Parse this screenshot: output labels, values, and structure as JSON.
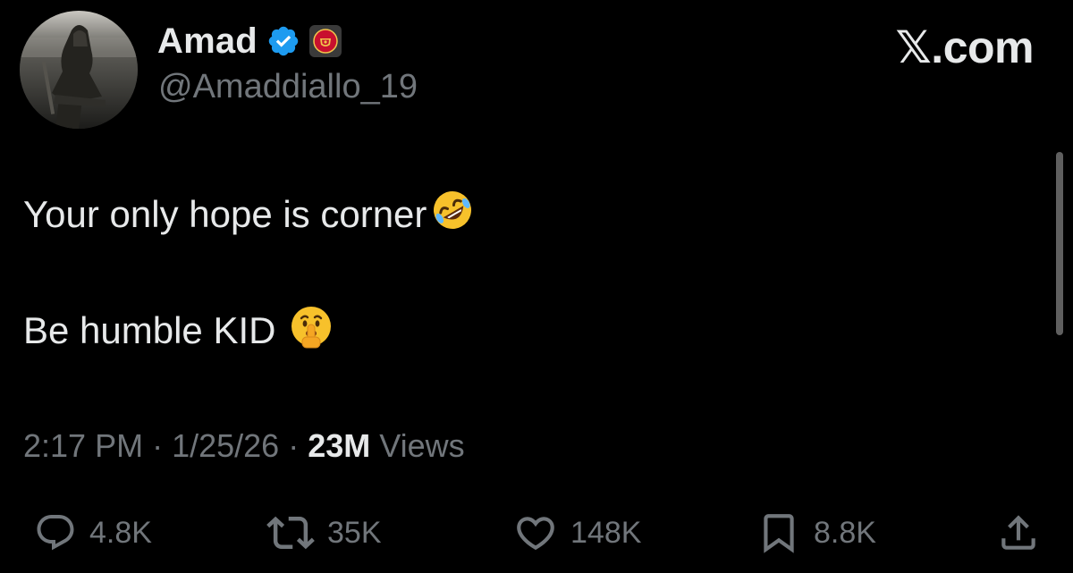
{
  "author": {
    "display_name": "Amad",
    "handle": "@Amaddiallo_19",
    "verified_icon": "verified-badge-icon",
    "affiliate_icon": "club-crest-icon"
  },
  "brand": "𝕏.com",
  "tweet": {
    "line1": "Your only hope is corner",
    "line1_emoji": "rolling-on-floor-laughing-emoji",
    "line2": "Be humble KID",
    "line2_emoji": "shushing-face-emoji"
  },
  "meta": {
    "time": "2:17 PM",
    "sep1": " · ",
    "date": "1/25/26",
    "sep2": " · ",
    "views_count": "23M",
    "views_label": " Views"
  },
  "actions": {
    "replies": "4.8K",
    "reposts": "35K",
    "likes": "148K",
    "bookmarks": "8.8K"
  },
  "colors": {
    "background": "#000000",
    "text": "#e7e9ea",
    "muted": "#71767b",
    "verified": "#1d9bf0"
  }
}
